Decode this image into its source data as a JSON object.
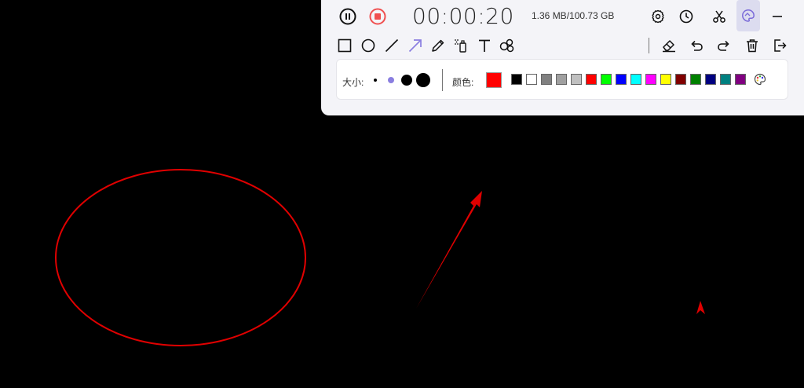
{
  "recorder": {
    "timer": "00:00:20",
    "storage": "1.36 MB/100.73 GB"
  },
  "draw_tools": [
    "rectangle-tool",
    "ellipse-tool",
    "line-tool",
    "arrow-tool",
    "pencil-tool",
    "spray-tool",
    "text-tool",
    "mosaic-tool"
  ],
  "active_tool": "arrow-tool",
  "settings_box": {
    "size_label": "大小:",
    "color_label": "颜色:",
    "current_color": "#ff0000",
    "swatches": [
      "#000000",
      "#ffffff",
      "#808080",
      "#a0a0a0",
      "#c0c0c0",
      "#ff0000",
      "#00ff00",
      "#0000ff",
      "#00ffff",
      "#ff00ff",
      "#ffff00",
      "#800000",
      "#008000",
      "#000080",
      "#008080",
      "#800080"
    ]
  },
  "accent_color": "#8a7ee0",
  "annotation_color": "#ff0000"
}
